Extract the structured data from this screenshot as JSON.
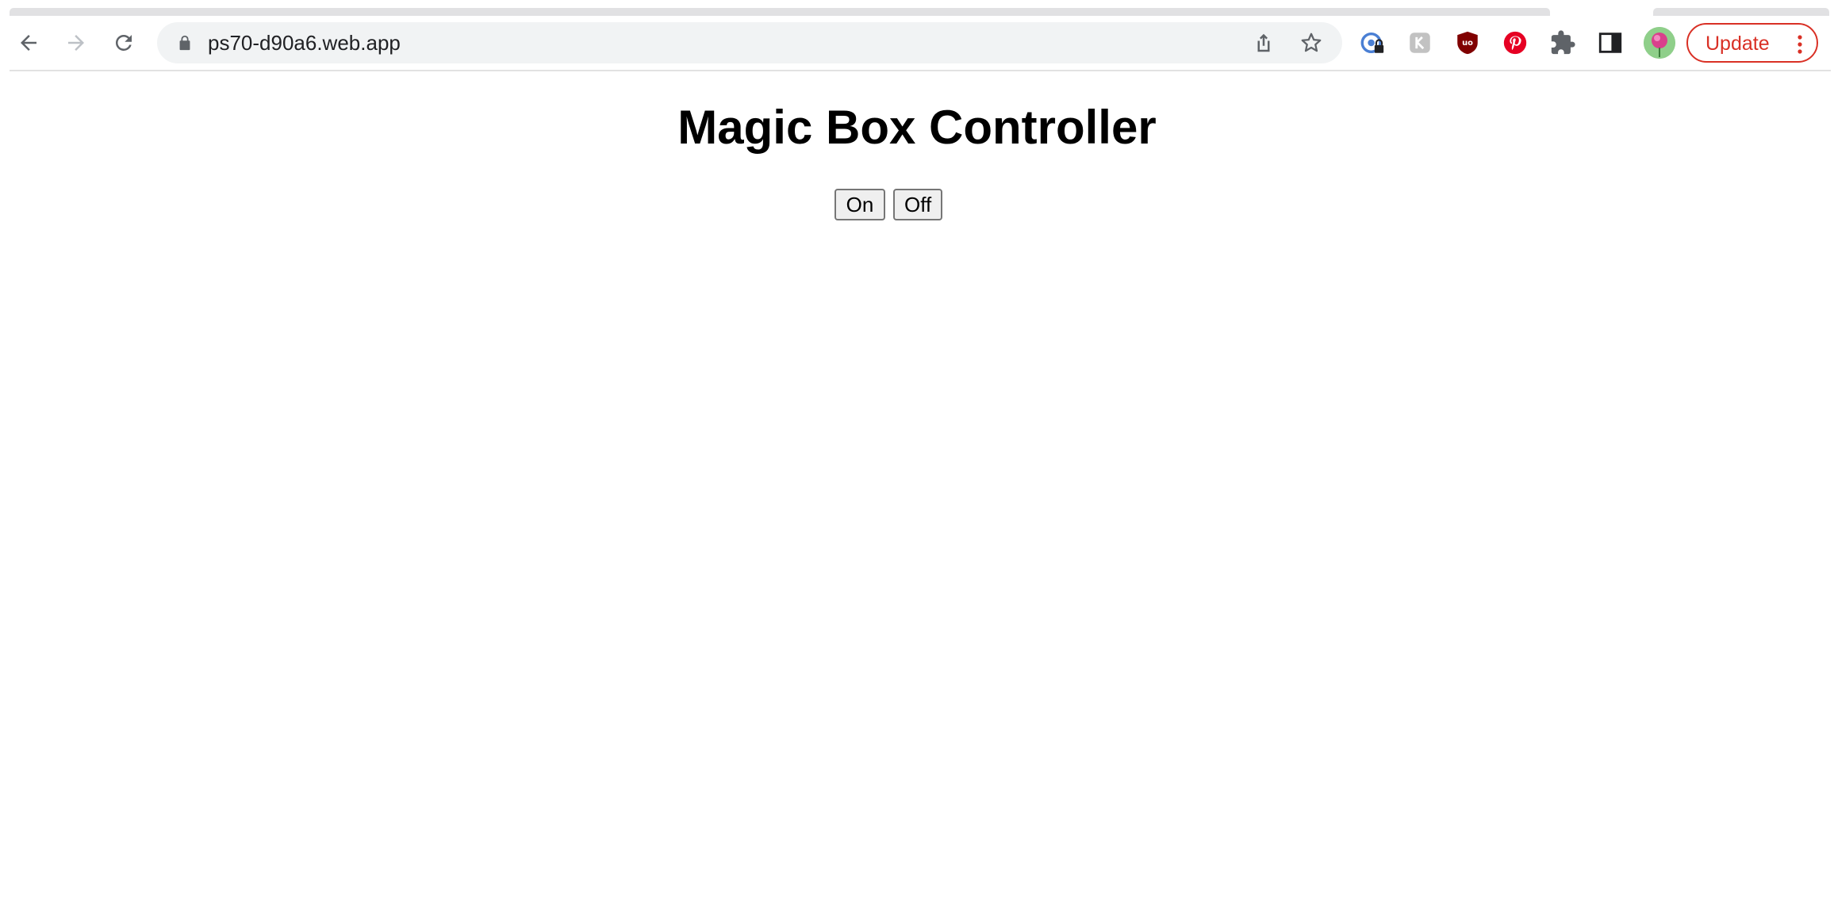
{
  "browser": {
    "url": "ps70-d90a6.web.app",
    "update_label": "Update",
    "accent_update": "#d93025",
    "icons": {
      "back": "arrow-left-icon",
      "forward": "arrow-right-icon",
      "reload": "reload-icon",
      "lock": "lock-icon",
      "share": "share-icon",
      "bookmark": "star-icon",
      "extensions": [
        "password-manager-icon",
        "kami-icon",
        "ublock-icon",
        "pinterest-icon",
        "puzzle-icon",
        "side-panel-icon"
      ],
      "menu": "kebab-menu-icon"
    }
  },
  "page": {
    "title": "Magic Box Controller",
    "buttons": {
      "on_label": "On",
      "off_label": "Off"
    }
  }
}
